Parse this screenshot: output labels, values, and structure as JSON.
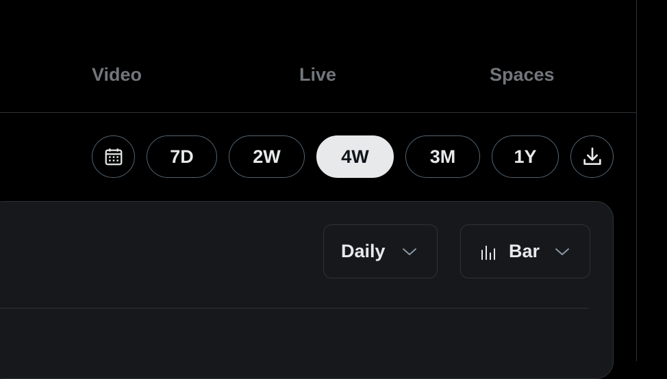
{
  "tabs": {
    "video": "Video",
    "live": "Live",
    "spaces": "Spaces"
  },
  "range": {
    "options": [
      "7D",
      "2W",
      "4W",
      "3M",
      "1Y"
    ],
    "selected": "4W"
  },
  "icons": {
    "calendar": "calendar-icon",
    "download": "download-icon",
    "chevron": "chevron-down-icon",
    "bar_chart": "bar-chart-icon"
  },
  "controls": {
    "interval_label": "Daily",
    "chart_type_label": "Bar"
  },
  "colors": {
    "background": "#000000",
    "panel": "#16181c",
    "border": "#2f3336",
    "text": "#e7e9ea",
    "muted_text": "#71767b",
    "selected_pill": "#e7e9ea"
  }
}
